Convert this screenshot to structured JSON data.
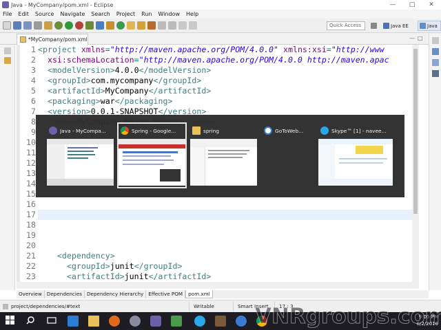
{
  "window": {
    "title": "Java - MyCompany/pom.xml - Eclipse",
    "controls": [
      "—",
      "□",
      "✕"
    ]
  },
  "menu": [
    "File",
    "Edit",
    "Source",
    "Navigate",
    "Search",
    "Project",
    "Run",
    "Window",
    "Help"
  ],
  "toolbar": {
    "quick_access": "Quick Access",
    "perspectives": {
      "java_ee": "Java EE",
      "java": "Java"
    }
  },
  "editor": {
    "tab_title": "*MyCompany/pom.xml",
    "lines": [
      {
        "num": "1",
        "indent": "",
        "parts": [
          [
            "tag",
            "<project "
          ],
          [
            "attr",
            "xmlns"
          ],
          [
            "br",
            "="
          ],
          [
            "val",
            "\"http://maven.apache.org/POM/4.0.0\""
          ],
          [
            "txt",
            " "
          ],
          [
            "attr",
            "xmlns:xsi"
          ],
          [
            "br",
            "="
          ],
          [
            "val",
            "\"http://www"
          ]
        ]
      },
      {
        "num": "2",
        "indent": "  ",
        "parts": [
          [
            "attr",
            "xsi:schemaLocation"
          ],
          [
            "br",
            "="
          ],
          [
            "val",
            "\"http://maven.apache.org/POM/4.0.0 http://maven.apac"
          ]
        ]
      },
      {
        "num": "3",
        "indent": "  ",
        "parts": [
          [
            "tag",
            "<modelVersion>"
          ],
          [
            "txt",
            "4.0.0"
          ],
          [
            "tag",
            "</modelVersion>"
          ]
        ]
      },
      {
        "num": "4",
        "indent": "  ",
        "parts": [
          [
            "tag",
            "<groupId>"
          ],
          [
            "txt",
            "com.mycompany"
          ],
          [
            "tag",
            "</groupId>"
          ]
        ]
      },
      {
        "num": "5",
        "indent": "  ",
        "parts": [
          [
            "tag",
            "<artifactId>"
          ],
          [
            "txt",
            "MyCompany"
          ],
          [
            "tag",
            "</artifactId>"
          ]
        ]
      },
      {
        "num": "6",
        "indent": "  ",
        "parts": [
          [
            "tag",
            "<packaging>"
          ],
          [
            "txt",
            "war"
          ],
          [
            "tag",
            "</packaging>"
          ]
        ]
      },
      {
        "num": "7",
        "indent": "  ",
        "parts": [
          [
            "tag",
            "<version>"
          ],
          [
            "txt",
            "0.0.1-SNAPSHOT"
          ],
          [
            "tag",
            "</version>"
          ]
        ]
      },
      {
        "num": "8",
        "indent": "  ",
        "parts": [
          [
            "tag",
            "<name>"
          ],
          [
            "txt",
            "MyCompany Maven Webapp"
          ],
          [
            "tag",
            "</name>"
          ]
        ]
      },
      {
        "num": "9",
        "indent": "",
        "parts": []
      },
      {
        "num": "10",
        "indent": "",
        "parts": []
      },
      {
        "num": "11",
        "indent": "",
        "parts": []
      },
      {
        "num": "12",
        "indent": "",
        "parts": []
      },
      {
        "num": "13",
        "indent": "",
        "parts": []
      },
      {
        "num": "14",
        "indent": "",
        "parts": []
      },
      {
        "num": "15",
        "indent": "",
        "parts": []
      },
      {
        "num": "16",
        "indent": "",
        "parts": []
      },
      {
        "num": "17",
        "indent": "",
        "parts": []
      },
      {
        "num": "18",
        "indent": "",
        "parts": []
      },
      {
        "num": "19",
        "indent": "",
        "parts": []
      },
      {
        "num": "20",
        "indent": "",
        "parts": []
      },
      {
        "num": "21",
        "indent": "    ",
        "parts": [
          [
            "tag",
            "<dependency>"
          ]
        ]
      },
      {
        "num": "22",
        "indent": "      ",
        "parts": [
          [
            "tag",
            "<groupId>"
          ],
          [
            "txt",
            "junit"
          ],
          [
            "tag",
            "</groupId>"
          ]
        ]
      },
      {
        "num": "23",
        "indent": "      ",
        "parts": [
          [
            "tag",
            "<artifactId>"
          ],
          [
            "txt",
            "junit"
          ],
          [
            "tag",
            "</artifactId>"
          ]
        ]
      }
    ]
  },
  "bottom_tabs": [
    "Overview",
    "Dependencies",
    "Dependency Hierarchy",
    "Effective POM",
    "pom.xml"
  ],
  "status": {
    "path": "project/dependencies/#text",
    "mode": "Writable",
    "insert": "Smart Insert",
    "position": "17 : 3"
  },
  "switcher": {
    "windows": [
      {
        "title": "Java - MyCompa...",
        "icon_color": "#6d5fa8"
      },
      {
        "title": "Spring - Google...",
        "icon_color": "#e0a91b"
      },
      {
        "title": "spring",
        "icon_color": "#e8c15a"
      },
      {
        "title": "GoToWeb...",
        "icon_color": "#ffffff"
      },
      {
        "title": "Skype™ [1] - navee...",
        "icon_color": "#2aa7e8"
      }
    ]
  },
  "taskbar": {
    "time": "9:05 PM",
    "date": "6/2/2016",
    "watermark": "VNRgroups.com"
  },
  "colors": {
    "accent": "#3874c8",
    "xml_tag": "#3f7f7f",
    "xml_attr": "#7f007f",
    "xml_value": "#2a00ff",
    "switcher_bg": "#2c2c2c",
    "taskbar_bg": "#1c1c22"
  }
}
